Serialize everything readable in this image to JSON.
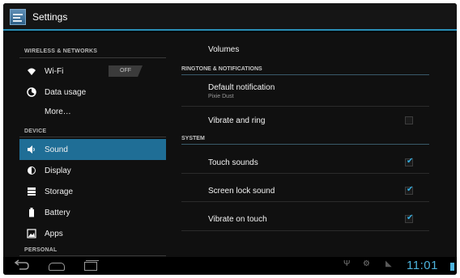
{
  "app": {
    "title": "Settings"
  },
  "left": {
    "sections": [
      {
        "header": "WIRELESS & NETWORKS"
      },
      {
        "header": "DEVICE"
      },
      {
        "header": "PERSONAL"
      }
    ],
    "items": [
      {
        "label": "Wi-Fi",
        "icon": "wifi-icon",
        "toggle": "OFF"
      },
      {
        "label": "Data usage",
        "icon": "data-usage-icon"
      },
      {
        "label": "More…"
      },
      {
        "label": "Sound",
        "icon": "volume-icon",
        "active": true
      },
      {
        "label": "Display",
        "icon": "brightness-icon"
      },
      {
        "label": "Storage",
        "icon": "storage-icon"
      },
      {
        "label": "Battery",
        "icon": "battery-icon"
      },
      {
        "label": "Apps",
        "icon": "apps-icon"
      }
    ]
  },
  "right": {
    "volumes_label": "Volumes",
    "sections": [
      {
        "header": "RINGTONE & NOTIFICATIONS"
      },
      {
        "header": "SYSTEM"
      }
    ],
    "items": [
      {
        "label": "Default notification",
        "summary": "Pixie Dust"
      },
      {
        "label": "Vibrate and ring",
        "checked": false
      },
      {
        "label": "Touch sounds",
        "checked": true
      },
      {
        "label": "Screen lock sound",
        "checked": true
      },
      {
        "label": "Vibrate on touch",
        "checked": true
      }
    ]
  },
  "statusbar": {
    "time": "11:01",
    "icons": [
      "usb-icon",
      "debug-icon",
      "signal-icon",
      "battery-icon"
    ]
  },
  "navbar": {
    "buttons": [
      "back-icon",
      "home-icon",
      "recent-apps-icon"
    ]
  },
  "colors": {
    "accent": "#34aee0",
    "selected": "#1f6e96",
    "background": "#101010"
  }
}
